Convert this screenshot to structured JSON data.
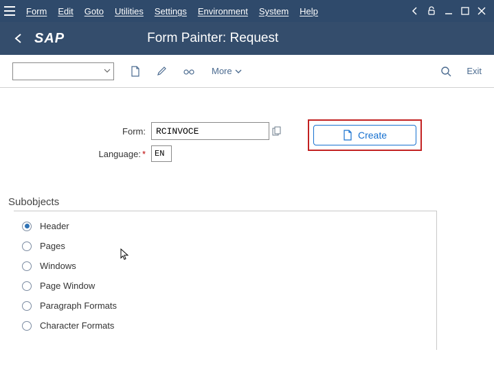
{
  "menubar": {
    "items": [
      "Form",
      "Edit",
      "Goto",
      "Utilities",
      "Settings",
      "Environment",
      "System",
      "Help"
    ]
  },
  "titlebar": {
    "title": "Form Painter: Request"
  },
  "toolbar": {
    "more": "More",
    "exit": "Exit"
  },
  "form": {
    "form_label": "Form:",
    "form_value": "RCINVOCE",
    "language_label": "Language:",
    "language_value": "EN",
    "create_label": "Create"
  },
  "subobjects": {
    "title": "Subobjects",
    "items": [
      {
        "label": "Header",
        "checked": true
      },
      {
        "label": "Pages",
        "checked": false
      },
      {
        "label": "Windows",
        "checked": false
      },
      {
        "label": "Page Window",
        "checked": false
      },
      {
        "label": "Paragraph Formats",
        "checked": false
      },
      {
        "label": "Character Formats",
        "checked": false
      }
    ]
  }
}
